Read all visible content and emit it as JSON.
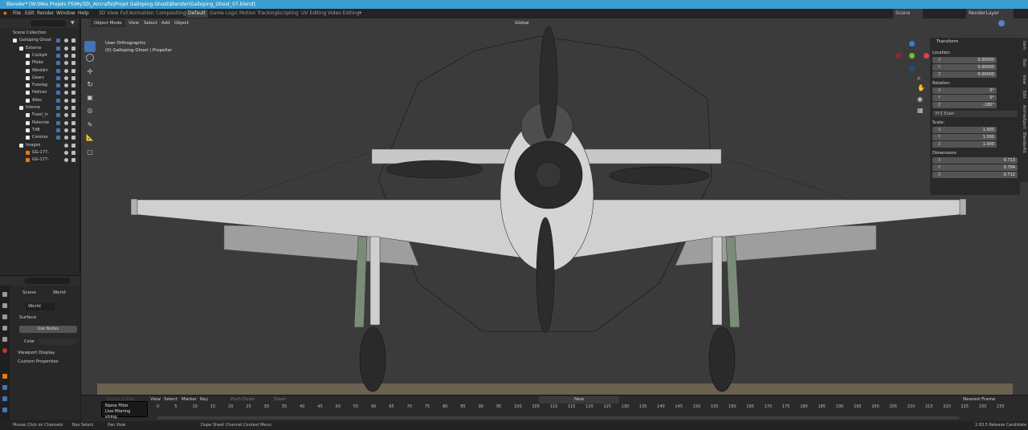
{
  "window": {
    "title": "Blender* [W:\\Mes Projets FS\\My3D\\_Aircrafts\\Projet Galloping Ghost\\Blender\\Galloping_Ghost_07.blend]"
  },
  "menu": [
    "File",
    "Edit",
    "Render",
    "Window",
    "Help"
  ],
  "workspaces": [
    "3D View Full",
    "Animation",
    "Compositing",
    "Default",
    "Game Logic",
    "Motion Tracking",
    "Scripting",
    "UV Editing",
    "Video Editing"
  ],
  "active_workspace": "Default",
  "scene": {
    "scene_name": "Scene",
    "render_layer": "RenderLayer",
    "options_label": "Options"
  },
  "outliner": {
    "rows": [
      {
        "label": "Scene Collection",
        "depth": 0
      },
      {
        "label": "Galloping Ghost",
        "depth": 1
      },
      {
        "label": "Externe",
        "depth": 2
      },
      {
        "label": "Cockpit",
        "depth": 3
      },
      {
        "label": "Pilote",
        "depth": 3
      },
      {
        "label": "Windshi",
        "depth": 3
      },
      {
        "label": "Gears",
        "depth": 3
      },
      {
        "label": "Fuselag",
        "depth": 3
      },
      {
        "label": "Helices",
        "depth": 3
      },
      {
        "label": "Ailes",
        "depth": 3
      },
      {
        "label": "Interne",
        "depth": 2
      },
      {
        "label": "Fusel_in",
        "depth": 3
      },
      {
        "label": "Palonnie",
        "depth": 3
      },
      {
        "label": "TdB",
        "depth": 3
      },
      {
        "label": "Comma",
        "depth": 3
      },
      {
        "label": "Images",
        "depth": 2
      },
      {
        "label": "GG-177-",
        "depth": 3
      },
      {
        "label": "GG-177-",
        "depth": 3
      }
    ]
  },
  "properties": {
    "scene_label": "Scene",
    "world_tab_label": "World",
    "world_name": "World",
    "surface_label": "Surface",
    "use_nodes_label": "Use Nodes",
    "color_label": "Color",
    "viewport_display_label": "Viewport Display",
    "custom_properties_label": "Custom Properties"
  },
  "viewport": {
    "mode": "Object Mode",
    "menus": [
      "View",
      "Select",
      "Add",
      "Object"
    ],
    "transform_orientation": "Global",
    "view_name": "User Orthographic",
    "object_info": "(0) Galloping Ghost | Propeller"
  },
  "n_panel": {
    "section": "Transform",
    "location_label": "Location:",
    "location": {
      "x": "0.00000",
      "y": "0.00000",
      "z": "0.00000"
    },
    "rotation_label": "Rotation:",
    "rotation": {
      "x": "0°",
      "y": "0°",
      "z": "-180°"
    },
    "rotation_mode": "XYZ Euler",
    "scale_label": "Scale:",
    "scale": {
      "x": "1.000",
      "y": "1.000",
      "z": "1.000"
    },
    "dimensions_label": "Dimensions:",
    "dimensions": {
      "x": "0.713",
      "y": "0.704",
      "z": "0.712"
    },
    "axis": {
      "x": "X",
      "y": "Y",
      "z": "Z"
    },
    "tabs": [
      "Item",
      "Tool",
      "View",
      "Edit",
      "AnimeXport",
      "BlenderKit"
    ]
  },
  "timeline": {
    "menus": [
      "View",
      "Select",
      "Marker",
      "Key"
    ],
    "push_down": "Push Down",
    "stash": "Stash",
    "new_label": "New",
    "filter_mode": "Nearest Frame",
    "action_editor": "Action Editor",
    "ticks": [
      "0",
      "5",
      "10",
      "15",
      "20",
      "25",
      "30",
      "35",
      "40",
      "45",
      "50",
      "55",
      "60",
      "65",
      "70",
      "75",
      "80",
      "85",
      "90",
      "95",
      "100",
      "105",
      "110",
      "115",
      "120",
      "125",
      "130",
      "135",
      "140",
      "145",
      "150",
      "155",
      "160",
      "165",
      "170",
      "175",
      "180",
      "185",
      "190",
      "195",
      "200",
      "205",
      "210",
      "215",
      "220",
      "225",
      "230",
      "235"
    ]
  },
  "tooltip": {
    "title": "Name Filter",
    "body": "Live filtering string."
  },
  "status": {
    "left": "Mouse Click on Channels",
    "box_select": "Box Select",
    "pan_view": "Pan View",
    "context": "Dope Sheet Channel Context Menu",
    "version": "2.93.5 Release Candidate"
  },
  "colors": {
    "accent": "#4772b3",
    "titlebar": "#3a9fd0",
    "viewport_bg": "#3b3b3b"
  }
}
